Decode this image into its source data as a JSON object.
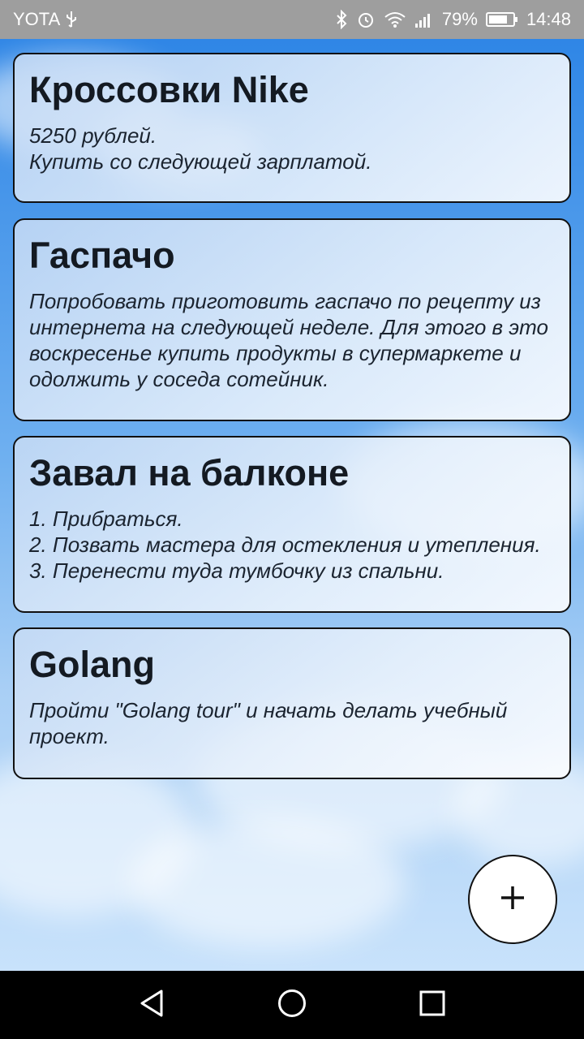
{
  "status_bar": {
    "carrier": "YOTA",
    "battery_percent": "79%",
    "time": "14:48"
  },
  "notes": [
    {
      "title": "Кроссовки Nike",
      "body": "5250 рублей.\nКупить со следующей зарплатой."
    },
    {
      "title": "Гаспачо",
      "body": "Попробовать приготовить гаспачо по рецепту из\nинтернета на следующей неделе. Для этого в это\nвоскресенье купить продукты в супермаркете и\nодолжить у соседа сотейник."
    },
    {
      "title": "Завал на балконе",
      "body": "1. Прибраться.\n2. Позвать мастера для остекления и утепления.\n3. Перенести туда тумбочку из спальни."
    },
    {
      "title": "Golang",
      "body": "Пройти \"Golang tour\" и начать делать учебный\nпроект."
    }
  ],
  "icons": {
    "fab": "plus-icon",
    "nav": [
      "back-icon",
      "home-icon",
      "recents-icon"
    ]
  }
}
